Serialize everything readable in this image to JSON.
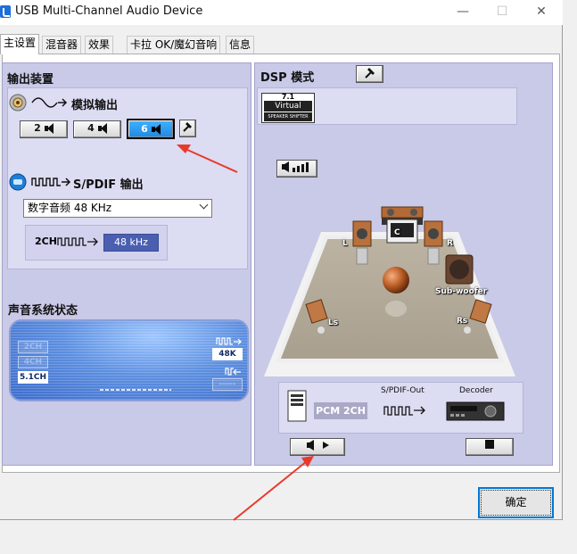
{
  "window": {
    "title": "USB Multi-Channel Audio Device",
    "minimize": "—",
    "maximize": "☐",
    "close": "✕"
  },
  "tabs": [
    "主设置",
    "混音器",
    "效果",
    "卡拉 OK/魔幻音响",
    "信息"
  ],
  "output_device": {
    "header": "输出装置",
    "analog_label": "模拟输出",
    "channel_buttons": [
      "2",
      "4",
      "6"
    ],
    "selected_channel": "6",
    "spdif_label": "S/PDIF 输出",
    "spdif_select_value": "数字音频 48 KHz",
    "spdif_chain_label": "2CH",
    "spdif_rate_badge": "48 kHz"
  },
  "sound_status": {
    "header": "声音系统状态",
    "channel_labels": [
      "2CH",
      "4CH",
      "5.1CH"
    ],
    "active_channel": "5.1CH",
    "sample_rate_label": "48K",
    "input_placeholder": "-----"
  },
  "dsp": {
    "header": "DSP 模式",
    "virtual_badge_top": "7.1",
    "virtual_badge_mid": "Virtual",
    "virtual_badge_bottom": "SPEAKER SHIFTER",
    "speakers": {
      "left": "L",
      "center": "C",
      "right": "R",
      "subwoofer": "Sub-woofer",
      "left_surround": "Ls",
      "right_surround": "Rs"
    },
    "output_chain": {
      "spdif_out_label": "S/PDIF-Out",
      "decoder_label": "Decoder",
      "format_label": "PCM 2CH"
    }
  },
  "footer": {
    "ok_label": "确定"
  },
  "colors": {
    "pane": "#c9c9e8",
    "selected_button": "#1f88e3",
    "annotation_arrow": "#e8392b",
    "accent_border": "#0078d7"
  }
}
